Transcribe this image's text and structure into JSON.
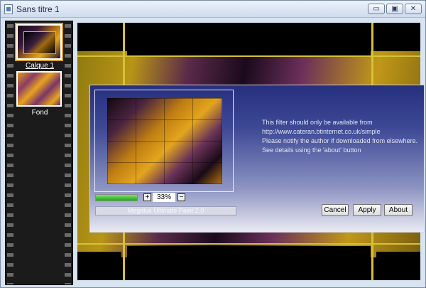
{
  "window": {
    "title": "Sans titre 1",
    "controls": {
      "minimize": "▭",
      "maximize": "▣",
      "close": "✕"
    }
  },
  "layers": [
    {
      "label": "Calque 1",
      "selected": true
    },
    {
      "label": "Fond",
      "selected": false
    }
  ],
  "dialog": {
    "zoom": {
      "value": "33%",
      "plus": "+",
      "minus": "−"
    },
    "progress": {
      "fraction": 1.0
    },
    "status": "Megalux Ultimate Paint 2.0",
    "info_lines": [
      "This filter should only be available from",
      "http://www.cateran.btinternet.co.uk/simple",
      "Please notify the author if downloaded from elsewhere.",
      "See details using the 'about' button"
    ],
    "buttons": {
      "cancel": "Cancel",
      "apply": "Apply",
      "about": "About"
    }
  },
  "colors": {
    "accent": "#d6c235",
    "dialog_top": "#262f7e",
    "progress_green": "#22a51a"
  }
}
